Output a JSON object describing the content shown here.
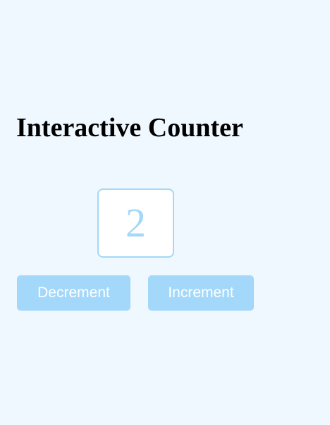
{
  "page": {
    "title": "Interactive Counter",
    "background_color": "#f0f8ff"
  },
  "counter": {
    "value": "2",
    "accent_color": "#a3d8f8"
  },
  "buttons": {
    "decrement_label": "Decrement",
    "increment_label": "Increment",
    "color": "#a3d8fb"
  }
}
